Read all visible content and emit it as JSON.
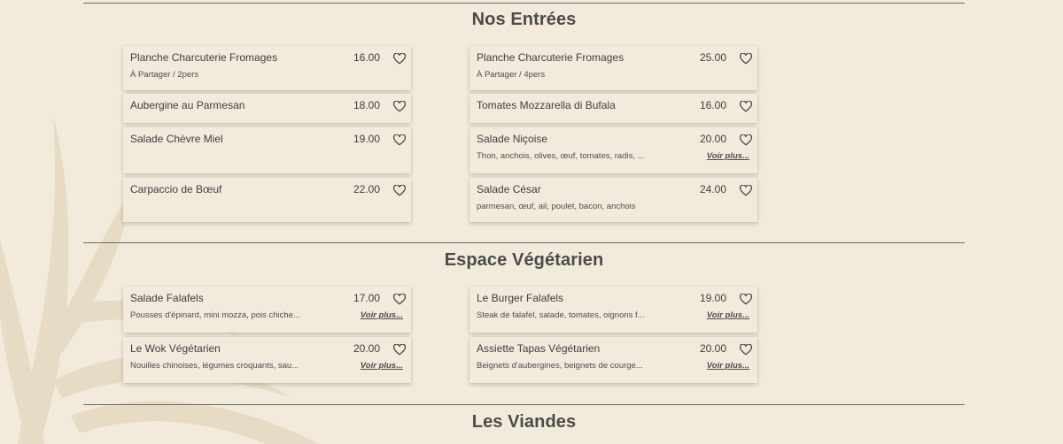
{
  "sections": [
    {
      "title": "Nos Entrées",
      "items": [
        {
          "name": "Planche Charcuterie Fromages",
          "price": "16.00",
          "desc": "À Partager / 2pers",
          "more": ""
        },
        {
          "name": "Planche Charcuterie Fromages",
          "price": "25.00",
          "desc": "À Partager / 4pers",
          "more": ""
        },
        {
          "name": "Aubergine au Parmesan",
          "price": "18.00",
          "desc": "",
          "more": ""
        },
        {
          "name": "Tomates Mozzarella di Bufala",
          "price": "16.00",
          "desc": "",
          "more": ""
        },
        {
          "name": "Salade Chèvre Miel",
          "price": "19.00",
          "desc": "",
          "more": ""
        },
        {
          "name": "Salade Niçoise",
          "price": "20.00",
          "desc": "Thon, anchois, olives, œuf, tomates, radis, ...",
          "more": "Voir plus..."
        },
        {
          "name": "Carpaccio de Bœuf",
          "price": "22.00",
          "desc": "",
          "more": ""
        },
        {
          "name": "Salade César",
          "price": "24.00",
          "desc": "parmesan, œuf, ail, poulet, bacon, anchois",
          "more": ""
        }
      ]
    },
    {
      "title": "Espace Végétarien",
      "items": [
        {
          "name": "Salade Falafels",
          "price": "17.00",
          "desc": "Pousses d'épinard, mini mozza, pois chiche...",
          "more": "Voir plus..."
        },
        {
          "name": "Le Burger Falafels",
          "price": "19.00",
          "desc": "Steak de falafel, salade, tomates, oignons f...",
          "more": "Voir plus..."
        },
        {
          "name": "Le Wok Végétarien",
          "price": "20.00",
          "desc": "Nouilles chinoises, légumes croquants, sau...",
          "more": "Voir plus..."
        },
        {
          "name": "Assiette Tapas Végétarien",
          "price": "20.00",
          "desc": "Beignets d'aubergines, beignets de courge...",
          "more": "Voir plus..."
        }
      ]
    },
    {
      "title": "Les Viandes",
      "items": []
    }
  ],
  "icons": {
    "favorite": "heart-outline-icon",
    "background": "palm-leaf-watermark"
  },
  "colors": {
    "background": "#f2ebdc",
    "text": "#4a4a4a",
    "rule": "#6b6b6b"
  }
}
